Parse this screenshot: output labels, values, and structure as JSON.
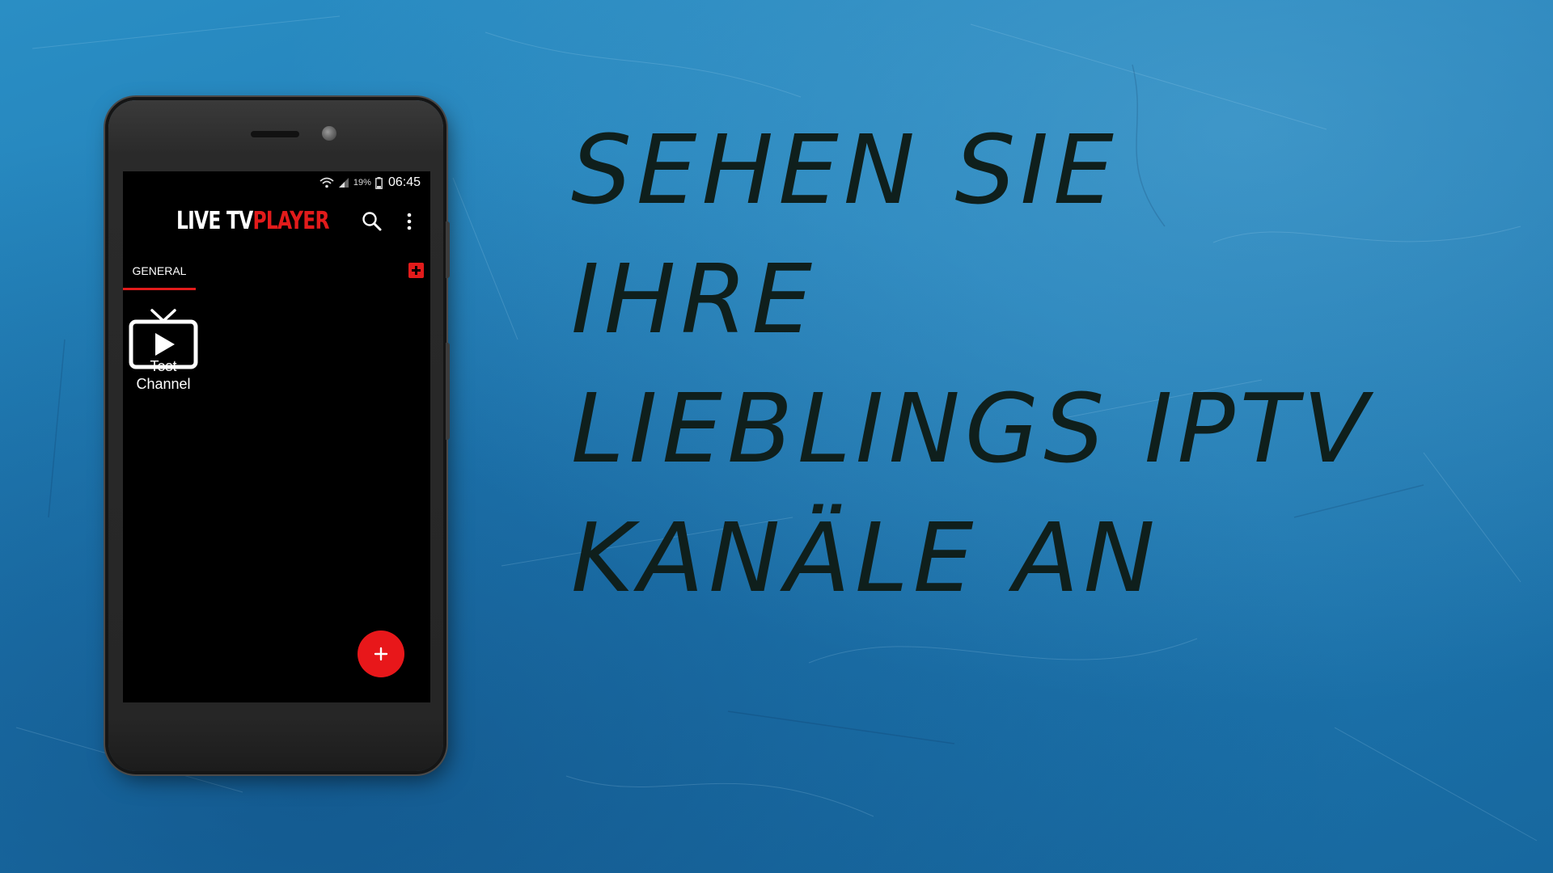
{
  "phone": {
    "status_bar": {
      "battery_percent": "19%",
      "time": "06:45",
      "icons": [
        "wifi-icon",
        "signal-icon",
        "battery-icon"
      ]
    },
    "app": {
      "logo_part1": "LIVE TV",
      "logo_part2": "PLAYER",
      "actions": [
        "search-icon",
        "more-vert-icon"
      ],
      "tabs": [
        {
          "label": "GENERAL",
          "selected": true
        }
      ],
      "channels": [
        {
          "name": "Test\nChannel",
          "icon": "tv-play-icon"
        }
      ],
      "fab_icon": "plus-icon"
    }
  },
  "headline": {
    "line1": "SEHEN SIE",
    "line2": "IHRE",
    "line3": "LIEBLINGS IPTV",
    "line4": "KANÄLE AN"
  },
  "colors": {
    "accent": "#e21b1b",
    "background": "#1e79b3",
    "headline_text": "#0f1f1c"
  }
}
